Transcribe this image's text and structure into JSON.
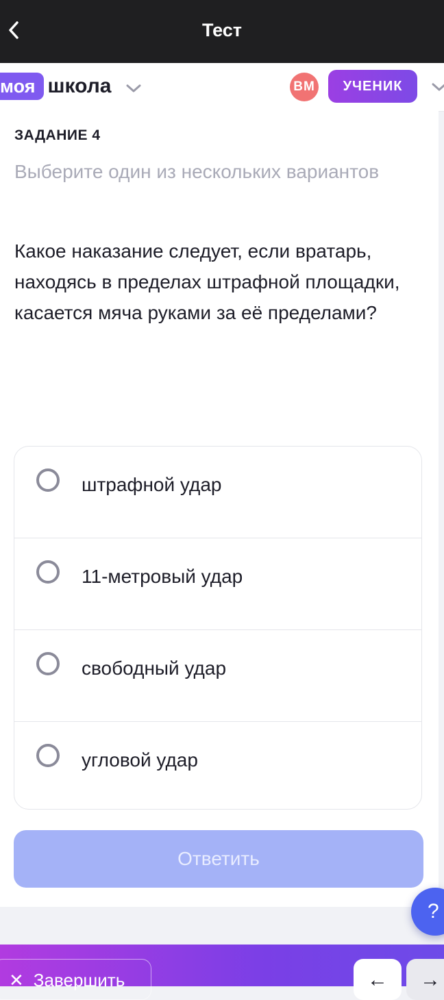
{
  "header": {
    "title": "Тест",
    "back_icon": "chevron-left-icon"
  },
  "school": {
    "logo_badge": "моя",
    "logo_text": "школа",
    "avatar_initials": "ВМ",
    "role_label": "УЧЕНИК",
    "colors": {
      "brand": "#7f5af0",
      "avatar": "#f17373"
    }
  },
  "task": {
    "number_label": "ЗАДАНИЕ 4",
    "hint": "Выберите один из нескольких вариантов",
    "question": "Какое наказание следует, если вратарь, находясь в пределах штрафной площадки, касается мяча руками за её пределами?"
  },
  "options": [
    {
      "label": "штрафной удар"
    },
    {
      "label": "11-метровый удар"
    },
    {
      "label": "свободный удар"
    },
    {
      "label": "угловой удар"
    }
  ],
  "submit_label": "Ответить",
  "help_label": "?",
  "footer": {
    "finish_label": "Завершить",
    "prev_label": "←",
    "next_label": "→"
  }
}
